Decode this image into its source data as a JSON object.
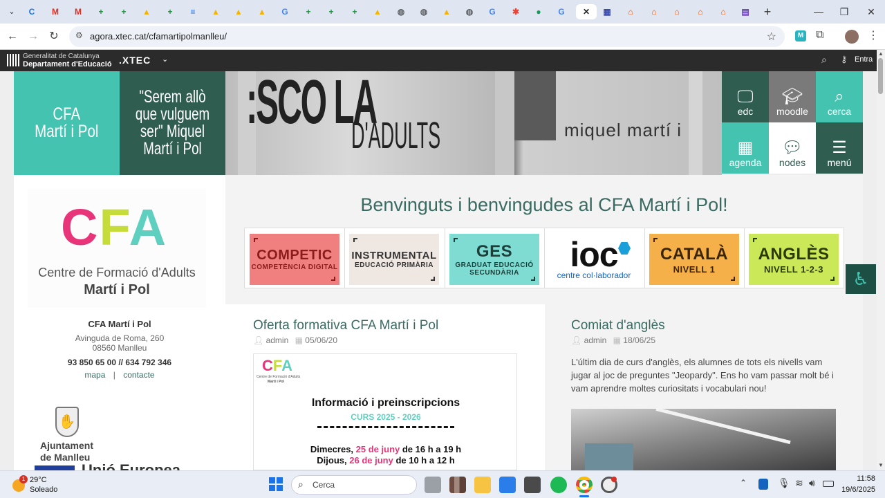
{
  "browser": {
    "tabs": [
      {
        "icon": "chrome-icon",
        "glyph": "C",
        "color": "#1a73e8"
      },
      {
        "icon": "gmail-icon",
        "glyph": "M",
        "color": "#d93025"
      },
      {
        "icon": "gmail-icon",
        "glyph": "M",
        "color": "#d93025"
      },
      {
        "icon": "sheets-icon",
        "glyph": "+",
        "color": "#1e8e3e"
      },
      {
        "icon": "sheets-icon",
        "glyph": "+",
        "color": "#1e8e3e"
      },
      {
        "icon": "drive-icon",
        "glyph": "▲",
        "color": "#f4b400"
      },
      {
        "icon": "sheets-icon",
        "glyph": "+",
        "color": "#1e8e3e"
      },
      {
        "icon": "docs-icon",
        "glyph": "≡",
        "color": "#1a73e8"
      },
      {
        "icon": "drive-icon",
        "glyph": "▲",
        "color": "#f4b400"
      },
      {
        "icon": "drive-icon",
        "glyph": "▲",
        "color": "#f4b400"
      },
      {
        "icon": "drive-icon",
        "glyph": "▲",
        "color": "#f4b400"
      },
      {
        "icon": "google-icon",
        "glyph": "G",
        "color": "#4285f4"
      },
      {
        "icon": "sheets-icon",
        "glyph": "+",
        "color": "#1e8e3e"
      },
      {
        "icon": "sheets-icon",
        "glyph": "+",
        "color": "#1e8e3e"
      },
      {
        "icon": "sheets-icon",
        "glyph": "+",
        "color": "#1e8e3e"
      },
      {
        "icon": "drive-icon",
        "glyph": "▲",
        "color": "#f4b400"
      },
      {
        "icon": "globe-icon",
        "glyph": "◍",
        "color": "#5f6368"
      },
      {
        "icon": "globe-icon",
        "glyph": "◍",
        "color": "#5f6368"
      },
      {
        "icon": "drive-icon",
        "glyph": "▲",
        "color": "#f4b400"
      },
      {
        "icon": "globe-icon",
        "glyph": "◍",
        "color": "#5f6368"
      },
      {
        "icon": "google-icon",
        "glyph": "G",
        "color": "#4285f4"
      },
      {
        "icon": "photos-icon",
        "glyph": "✱",
        "color": "#ea4335"
      },
      {
        "icon": "app-icon",
        "glyph": "●",
        "color": "#0f9d58"
      },
      {
        "icon": "google-icon",
        "glyph": "G",
        "color": "#4285f4"
      },
      {
        "icon": "close-icon",
        "glyph": "✕",
        "color": "#202124",
        "active": true
      },
      {
        "icon": "calendar-icon",
        "glyph": "▦",
        "color": "#3949ab"
      },
      {
        "icon": "xtec-icon",
        "glyph": "⌂",
        "color": "#e8590c"
      },
      {
        "icon": "xtec-icon",
        "glyph": "⌂",
        "color": "#e8590c"
      },
      {
        "icon": "xtec-icon",
        "glyph": "⌂",
        "color": "#e8590c"
      },
      {
        "icon": "xtec-icon",
        "glyph": "⌂",
        "color": "#e8590c"
      },
      {
        "icon": "xtec-icon",
        "glyph": "⌂",
        "color": "#e8590c"
      },
      {
        "icon": "forms-icon",
        "glyph": "▤",
        "color": "#673ab7"
      }
    ],
    "url": "agora.xtec.cat/cfamartipolmanlleu/"
  },
  "gencat": {
    "line1": "Generalitat de Catalunya",
    "line2": "Departament d'Educació",
    "xtec": ".XTEC",
    "login": "Entra"
  },
  "hero": {
    "school_name": "CFA\nMartí i Pol",
    "quote": "\"Serem allò que vulguem ser\" Miquel Martí i Pol",
    "photo_text_top": ":SCO LA",
    "photo_text_bottom": "D'ADULTS",
    "photo_sign": "miquel martí i",
    "tiles": [
      {
        "label": "edc",
        "bg": "#2f5d50"
      },
      {
        "label": "moodle",
        "bg": "#7a7a7a"
      },
      {
        "label": "cerca",
        "bg": "#44c4b0"
      },
      {
        "label": "agenda",
        "bg": "#44c4b0"
      },
      {
        "label": "nodes",
        "bg": "#ffffff",
        "fg": "#2f5d50"
      },
      {
        "label": "menú",
        "bg": "#2f5d50"
      }
    ]
  },
  "sidebar": {
    "logo_letters": "CFA",
    "logo_line1": "Centre de Formació d'Adults",
    "logo_line2": "Martí i Pol",
    "name": "CFA Martí i Pol",
    "address1": "Avinguda de Roma, 260",
    "address2": "08560 Manlleu",
    "phone": "93 850 65 00 // 634 792 346",
    "link_map": "mapa",
    "separator": "|",
    "link_contact": "contacte",
    "ajuntament1": "Ajuntament",
    "ajuntament2": "de Manlleu",
    "eu": "Unió Europea"
  },
  "main": {
    "welcome": "Benvinguts i benvingudes al CFA Martí i Pol!",
    "courses": [
      {
        "title": "COMPETIC",
        "sub": "COMPETÈNCIA DIGITAL",
        "bg": "#f08080",
        "fg": "#8b1a1a"
      },
      {
        "title": "INSTRUMENTAL",
        "sub": "EDUCACIÓ PRIMÀRIA",
        "bg": "#efe8e2",
        "fg": "#333333"
      },
      {
        "title": "GES",
        "sub": "GRADUAT EDUCACIÓ SECUNDÀRIA",
        "bg": "#7fdcd3",
        "fg": "#1c3f3a"
      },
      {
        "title": "ioc",
        "sub": "centre col·laborador",
        "bg": "#ffffff",
        "fg": "#111111"
      },
      {
        "title": "CATALÀ",
        "sub": "NIVELL 1",
        "bg": "#f6b04a",
        "fg": "#3a2500"
      },
      {
        "title": "ANGLÈS",
        "sub": "NIVELL 1-2-3",
        "bg": "#cbe859",
        "fg": "#2a3a00"
      }
    ],
    "post1": {
      "title": "Oferta formativa CFA Martí i Pol",
      "author": "admin",
      "date": "05/06/20",
      "poster_logo": "CFA",
      "poster_logo_sub1": "Centre de Formació d'Adults",
      "poster_logo_sub2": "Martí i Pol",
      "poster_title": "Informació i preinscripcions",
      "poster_year": "CURS 2025 - 2026",
      "poster_line1_a": "Dimecres, ",
      "poster_line1_b": "25 de juny",
      "poster_line1_c": " de 16 h a 19 h",
      "poster_line2_a": "Dijous, ",
      "poster_line2_b": "26 de juny",
      "poster_line2_c": " de 10 h a 12 h"
    },
    "post2": {
      "title": "Comiat d'anglès",
      "author": "admin",
      "date": "18/06/25",
      "body": "L'últim dia de curs d'anglès, els alumnes de tots els nivells vam jugar al joc de preguntes \"Jeopardy\". Ens ho vam passar molt bé i vam aprendre moltes curiositats i vocabulari nou!"
    }
  },
  "taskbar": {
    "weather_badge": "1",
    "temp": "29°C",
    "condition": "Soleado",
    "search": "Cerca",
    "time": "11:58",
    "date": "19/6/2025"
  },
  "colors": {
    "teal": "#44c4b0",
    "dark_green": "#2f5d50",
    "heading": "#3a6b62"
  }
}
